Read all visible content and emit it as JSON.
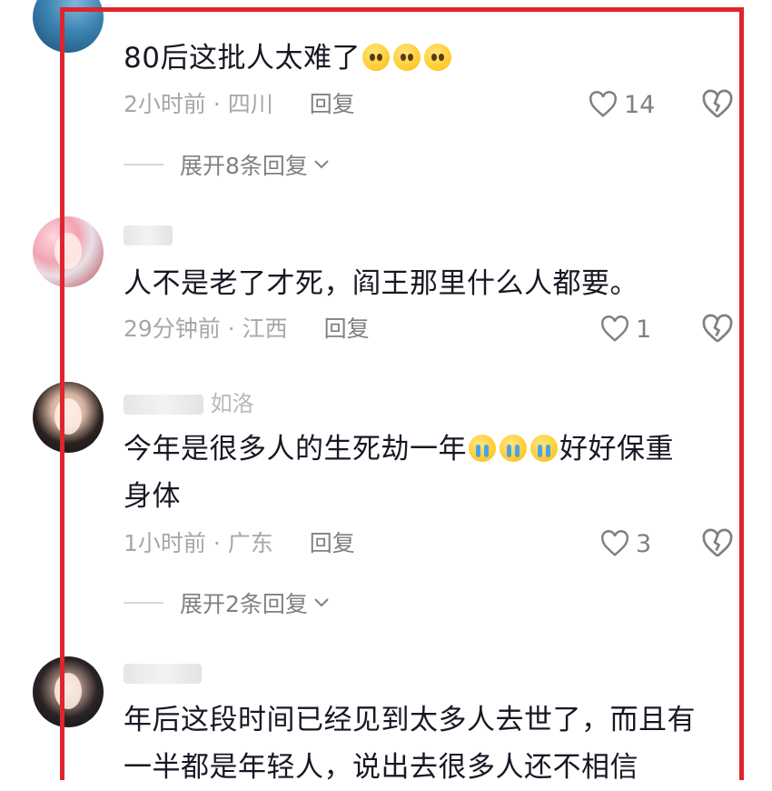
{
  "comments": [
    {
      "text": "80后这批人太难了",
      "emoji_count": 3,
      "meta": "2小时前 · 四川",
      "reply_label": "回复",
      "likes": "14",
      "expand": "展开8条回复"
    },
    {
      "text": "人不是老了才死，阎王那里什么人都要。",
      "meta": "29分钟前 · 江西",
      "reply_label": "回复",
      "likes": "1"
    },
    {
      "nick_visible": "如洛",
      "text_a": "今年是很多人的生死劫一年",
      "text_b": "好好保重",
      "text_c": "身体",
      "meta": "1小时前 · 广东",
      "reply_label": "回复",
      "likes": "3",
      "expand": "展开2条回复"
    },
    {
      "text_line1": "年后这段时间已经见到太多人去世了，而且有",
      "text_line2": "一半都是年轻人，说出去很多人还不相信"
    }
  ],
  "icons": {
    "like": "heart-outline-icon",
    "dislike": "broken-heart-icon",
    "expand": "chevron-down-icon"
  },
  "colors": {
    "highlight_frame": "#e0242e",
    "meta_text": "#a6a7ab"
  }
}
